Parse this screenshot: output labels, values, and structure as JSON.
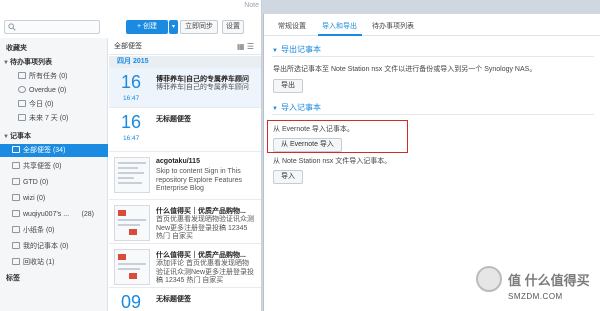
{
  "app": {
    "title": "Note",
    "search_placeholder": "",
    "create_label": "+ 创建",
    "create_dropdown": "▾",
    "sync_label": "立即同步",
    "settings_label": "设置"
  },
  "sidebar": {
    "favorites": "收藏夹",
    "todo_header": "待办事项列表",
    "todo_items": [
      {
        "label": "所有任务",
        "count": "(0)"
      },
      {
        "label": "Overdue",
        "count": "(0)"
      },
      {
        "label": "今日",
        "count": "(0)"
      },
      {
        "label": "未来 7 天",
        "count": "(0)"
      }
    ],
    "notebook_header": "记事本",
    "notebook_items": [
      {
        "label": "全部便签",
        "count": "(34)"
      },
      {
        "label": "共享便签",
        "count": "(0)"
      },
      {
        "label": "GTD",
        "count": "(0)"
      },
      {
        "label": "wizi",
        "count": "(0)"
      },
      {
        "label": "wuqiyu007's ...",
        "count": "(28)"
      },
      {
        "label": "小纸条",
        "count": "(0)"
      },
      {
        "label": "我的记事本",
        "count": "(0)"
      },
      {
        "label": "回收站",
        "count": "(1)"
      }
    ],
    "tags": "标签"
  },
  "notelist": {
    "header": "全部便签",
    "month": "四月 2015",
    "notes": [
      {
        "day": "16",
        "time": "16:47",
        "title": "博菲养车|自己的专属养车顾问",
        "body": "博菲养车|自己的专属养车顾问"
      },
      {
        "day": "16",
        "time": "16:47",
        "title": "无标题便签",
        "body": ""
      },
      {
        "title": "acgotaku/115",
        "body": "Skip to content Sign in This repository Explore Features Enterprise Blog"
      },
      {
        "title": "什么值得买｜优质产品购物...",
        "body": "首页优惠看发现晒物验证讯众测New更多注册登录投稿 12345 热门 自家买"
      },
      {
        "title": "什么值得买｜优质产品购物...",
        "body": "添加评论 首页优惠看发现晒物验证讯众测New更多注册登录投稿 12345 热门 自家买"
      },
      {
        "day": "09",
        "title": "无标题便签",
        "body": ""
      }
    ]
  },
  "panel": {
    "tabs": [
      "常规设置",
      "导入和导出",
      "待办事项列表"
    ],
    "export_title": "导出记事本",
    "export_desc": "导出所选记事本至 Note Station nsx 文件以进行备份或导入到另一个 Synology NAS。",
    "export_button": "导出",
    "import_title": "导入记事本",
    "evernote_desc": "从 Evernote 导入记事本。",
    "evernote_button": "从 Evernote 导入",
    "nsx_desc": "从 Note Station nsx 文件导入记事本。",
    "import_button": "导入"
  },
  "watermark": {
    "main": "值 什么值得买",
    "sub": "SMZDM.COM"
  },
  "colors": {
    "accent": "#1a8be0",
    "highlight_box": "#d42a2a"
  }
}
